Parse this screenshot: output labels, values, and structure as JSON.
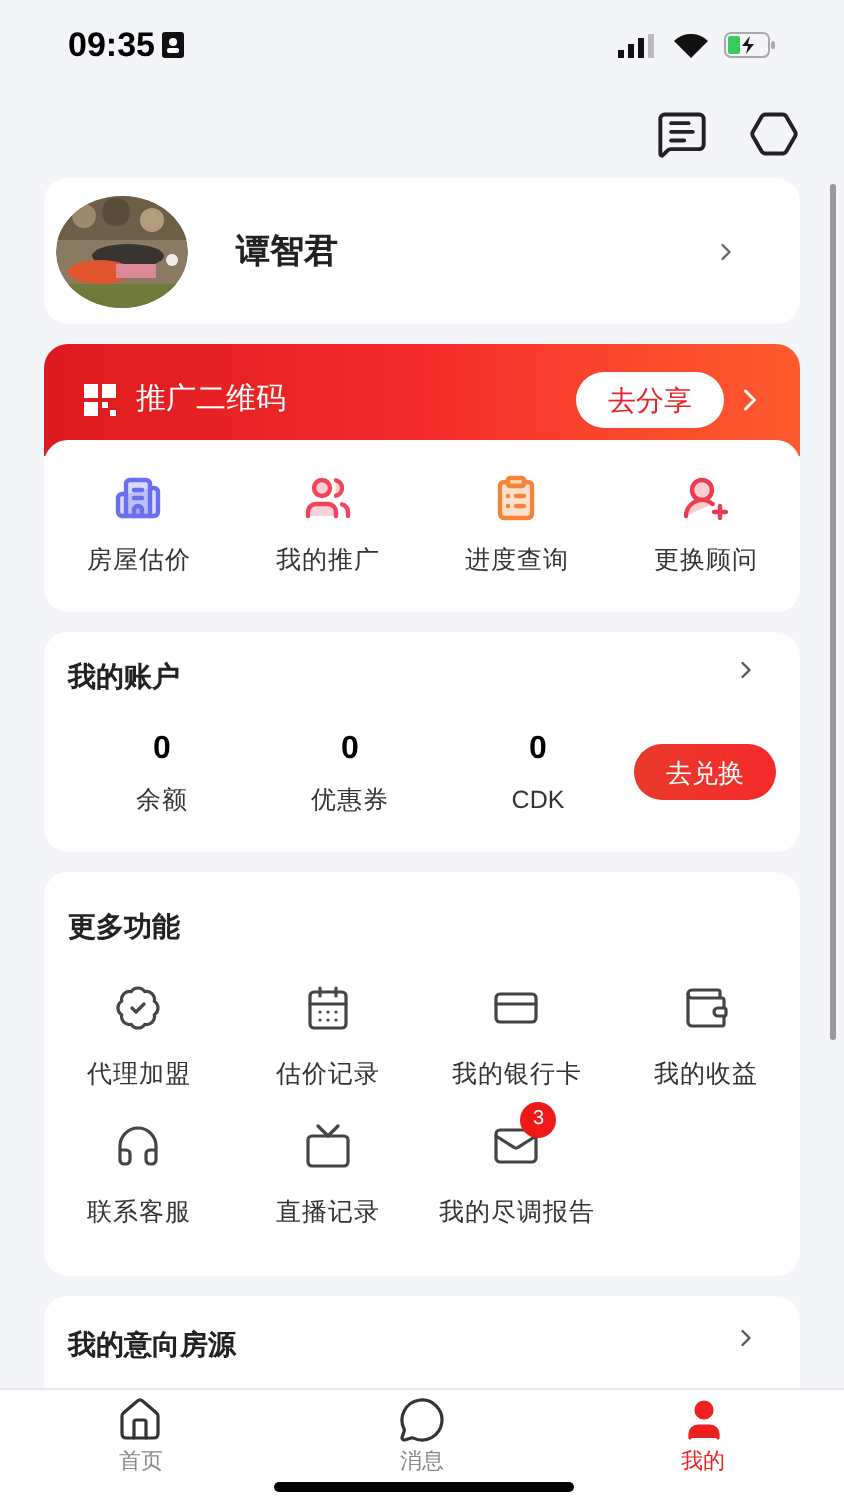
{
  "status_bar": {
    "time": "09:35"
  },
  "profile": {
    "name": "谭智君"
  },
  "promo": {
    "title": "推广二维码",
    "button": "去分享"
  },
  "quick_actions": [
    {
      "label": "房屋估价",
      "color": "#6a6ef0"
    },
    {
      "label": "我的推广",
      "color": "#f0455a"
    },
    {
      "label": "进度查询",
      "color": "#f5843a"
    },
    {
      "label": "更换顾问",
      "color": "#ef3b4b"
    }
  ],
  "account": {
    "title": "我的账户",
    "stats": [
      {
        "value": "0",
        "label": "余额"
      },
      {
        "value": "0",
        "label": "优惠券"
      },
      {
        "value": "0",
        "label": "CDK"
      }
    ],
    "button": "去兑换"
  },
  "more_functions": {
    "title": "更多功能",
    "items": [
      {
        "label": "代理加盟"
      },
      {
        "label": "估价记录"
      },
      {
        "label": "我的银行卡"
      },
      {
        "label": "我的收益"
      },
      {
        "label": "联系客服"
      },
      {
        "label": "直播记录"
      },
      {
        "label": "我的尽调报告",
        "badge": "3"
      }
    ]
  },
  "intent_listings": {
    "title": "我的意向房源"
  },
  "tab_bar": [
    {
      "label": "首页",
      "selected": false
    },
    {
      "label": "消息",
      "selected": false
    },
    {
      "label": "我的",
      "selected": true
    }
  ]
}
